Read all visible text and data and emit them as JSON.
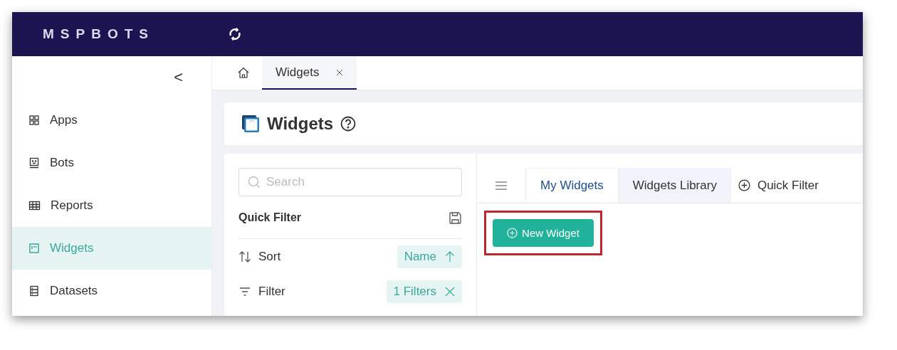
{
  "header": {
    "logo": "MSPBOTS"
  },
  "sidebar": {
    "collapse": "<",
    "items": [
      {
        "kind": "apps",
        "label": "Apps",
        "selected": false
      },
      {
        "kind": "bots",
        "label": "Bots",
        "selected": false
      },
      {
        "kind": "reports",
        "label": "Reports",
        "selected": false
      },
      {
        "kind": "widgets",
        "label": "Widgets",
        "selected": true
      },
      {
        "kind": "datasets",
        "label": "Datasets",
        "selected": false
      }
    ]
  },
  "page_tabs": [
    {
      "kind": "home",
      "selected": false
    },
    {
      "kind": "page",
      "label": "Widgets",
      "selected": true
    }
  ],
  "page": {
    "title": "Widgets"
  },
  "filter_panel": {
    "search": {
      "placeholder": "Search"
    },
    "title": "Quick Filter",
    "rows": [
      {
        "kind": "sort",
        "label": "Sort",
        "tag": "Name"
      },
      {
        "kind": "filter",
        "label": "Filter",
        "tag": "1 Filters"
      }
    ]
  },
  "content": {
    "tabs": [
      {
        "label": "My Widgets",
        "selected": true
      },
      {
        "label": "Widgets Library",
        "selected": false
      }
    ],
    "quick_filter": "Quick Filter",
    "new_button": {
      "label": "New Widget",
      "highlighted": true
    }
  }
}
